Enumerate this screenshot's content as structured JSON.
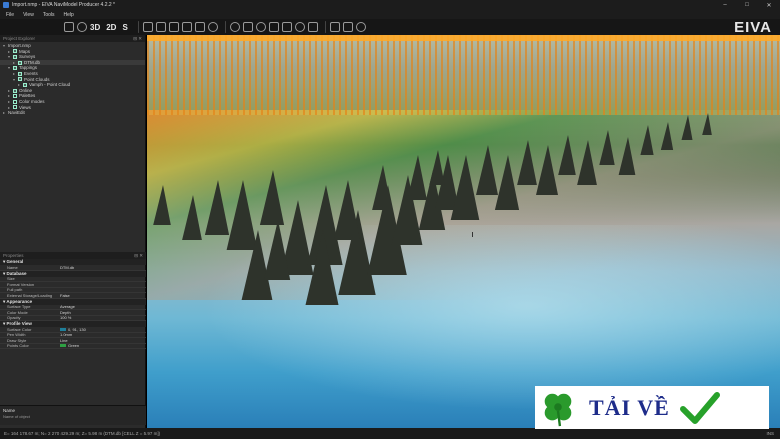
{
  "window": {
    "title": "Import.nmp - EIVA NaviModel Producer 4.2.2 *",
    "controls": {
      "minimize": "–",
      "maximize": "□",
      "close": "✕"
    }
  },
  "menu": [
    "File",
    "View",
    "Tools",
    "Help"
  ],
  "toolbar": {
    "view_modes": [
      "3D",
      "2D",
      "S"
    ],
    "icons": [
      "grid-icon",
      "layers-icon",
      "camera-icon",
      "ruler-icon",
      "measure-icon",
      "pin-icon",
      "sphere-icon",
      "profile-icon",
      "settings-icon",
      "pointer-icon",
      "pan-icon",
      "zoom-icon"
    ]
  },
  "brand": "EIVA",
  "project_explorer": {
    "header": "Project Explorer",
    "items": [
      {
        "label": "Import.nmp",
        "indent": 0,
        "checked": false,
        "expanded": true
      },
      {
        "label": "Maps",
        "indent": 1,
        "checked": true,
        "expanded": false
      },
      {
        "label": "Surveys",
        "indent": 1,
        "checked": true,
        "expanded": true
      },
      {
        "label": "DTM.db",
        "indent": 2,
        "checked": true,
        "expanded": false,
        "selected": true
      },
      {
        "label": "Tappings",
        "indent": 1,
        "checked": true,
        "expanded": true
      },
      {
        "label": "Events",
        "indent": 2,
        "checked": true,
        "expanded": false
      },
      {
        "label": "Point Clouds",
        "indent": 2,
        "checked": true,
        "expanded": true
      },
      {
        "label": "Vamph - Point Cloud",
        "indent": 3,
        "checked": true,
        "expanded": false
      },
      {
        "label": "Online",
        "indent": 1,
        "checked": true,
        "expanded": false
      },
      {
        "label": "Palettes",
        "indent": 1,
        "checked": false,
        "expanded": false
      },
      {
        "label": "Color modes",
        "indent": 1,
        "checked": false,
        "expanded": false
      },
      {
        "label": "Views",
        "indent": 1,
        "checked": false,
        "expanded": false
      },
      {
        "label": "NaviEdit",
        "indent": 0,
        "checked": false,
        "expanded": false
      }
    ]
  },
  "properties": {
    "header": "Properties",
    "sections": [
      {
        "title": "General",
        "rows": [
          {
            "key": "Name",
            "value": "DTM.db"
          }
        ]
      },
      {
        "title": "Database",
        "rows": [
          {
            "key": "Size",
            "value": ""
          },
          {
            "key": "Format Version",
            "value": ""
          },
          {
            "key": "Full path",
            "value": ""
          },
          {
            "key": "External Storage/Loading",
            "value": "False"
          }
        ]
      },
      {
        "title": "Appearance",
        "rows": [
          {
            "key": "Surface Type",
            "value": "Average"
          },
          {
            "key": "Color Mode",
            "value": "Depth"
          },
          {
            "key": "Opacity",
            "value": "100 %"
          }
        ]
      },
      {
        "title": "Profile View",
        "rows": [
          {
            "key": "Surface Color",
            "value": "0, 91, 130",
            "swatch": "#1f7f9a"
          },
          {
            "key": "Pen Width",
            "value": "1.0mm"
          },
          {
            "key": "Draw Style",
            "value": "Line"
          },
          {
            "key": "Points Color",
            "value": "Green",
            "swatch": "#2ea043"
          }
        ]
      }
    ]
  },
  "name_box": {
    "heading": "Name",
    "description": "Name of object"
  },
  "status": {
    "left": "E= 164 178.67 m; N= 2 270 429.29 m; Z= 5.98 m (DTM.db [CELL Z = 5.97 m])",
    "right": "INS"
  },
  "watermark": {
    "text": "TẢI VỀ",
    "colors": {
      "text": "#1e2c8a",
      "check": "#27a12a",
      "clover": "#2a9a2c"
    }
  }
}
